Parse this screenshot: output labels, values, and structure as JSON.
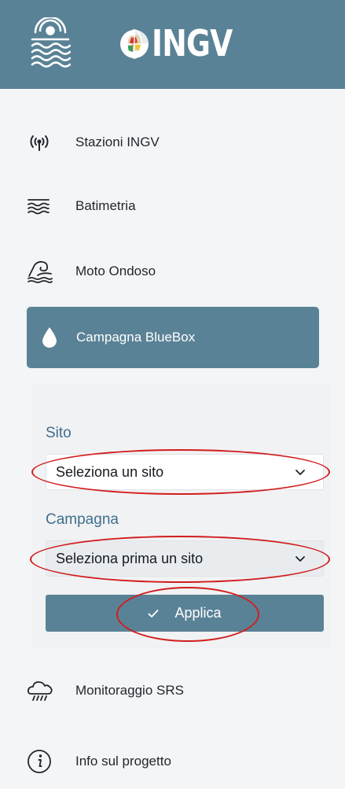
{
  "header": {
    "brand": "INGV"
  },
  "nav": {
    "stazioni": "Stazioni INGV",
    "batimetria": "Batimetria",
    "moto_ondoso": "Moto Ondoso",
    "campagna": "Campagna BlueBox",
    "monitoraggio": "Monitoraggio SRS",
    "info": "Info sul progetto"
  },
  "panel": {
    "sito_label": "Sito",
    "sito_value": "Seleziona un sito",
    "campagna_label": "Campagna",
    "campagna_value": "Seleziona prima un sito",
    "apply_label": "Applica"
  },
  "icons": {
    "stazioni": "radio-tower-icon",
    "batimetria": "waves-icon",
    "moto_ondoso": "wave-icon",
    "campagna": "water-drop-icon",
    "monitoraggio": "rain-cloud-icon",
    "info": "info-icon"
  },
  "colors": {
    "brand": "#5a8296",
    "label": "#3f6f8d",
    "highlight": "#d21c1c",
    "background": "#f4f5f6"
  }
}
